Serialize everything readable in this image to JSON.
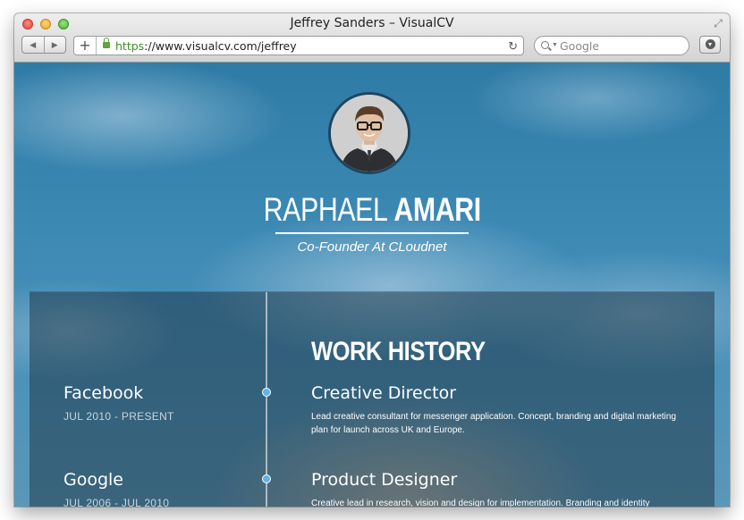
{
  "browser": {
    "window_title": "Jeffrey Sanders – VisualCV",
    "url_scheme": "https",
    "url_rest": "://www.visualcv.com/jeffrey",
    "search_placeholder": "Google"
  },
  "profile": {
    "first_name": "RAPHAEL",
    "last_name": "AMARI",
    "role": "Co-Founder At CLoudnet"
  },
  "work_history": {
    "title": "WORK HISTORY",
    "entries": [
      {
        "company": "Facebook",
        "period": "JUL 2010 - PRESENT",
        "job_title": "Creative Director",
        "description": "Lead creative consultant for messenger application. Concept, branding and digital marketing plan for launch across UK and Europe."
      },
      {
        "company": "Google",
        "period": "JUL 2006 - JUL 2010",
        "job_title": "Product Designer",
        "description": "Creative lead in research, vision and design for implementation. Branding and identity"
      }
    ]
  },
  "colors": {
    "accent_dot": "#5fb3e8",
    "url_scheme": "#3c8f2a"
  }
}
